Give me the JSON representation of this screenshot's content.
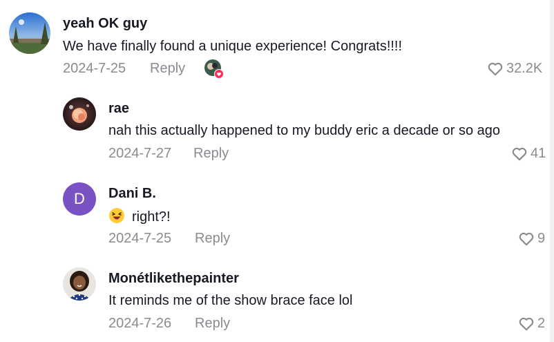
{
  "comments": [
    {
      "username": "yeah OK guy",
      "text": "We have finally found a unique experience! Congrats!!!!",
      "date": "2024-7-25",
      "reply_label": "Reply",
      "likes": "32.2K"
    }
  ],
  "replies": [
    {
      "username": "rae",
      "text": "nah this actually happened to my buddy eric a decade or so ago",
      "date": "2024-7-27",
      "reply_label": "Reply",
      "likes": "41"
    },
    {
      "username": "Dani B.",
      "avatar_letter": "D",
      "emoji_icon": "laughing-emoji",
      "text": "right?!",
      "date": "2024-7-25",
      "reply_label": "Reply",
      "likes": "9"
    },
    {
      "username": "Monétlikethepainter",
      "text": "It reminds me of the show brace face lol",
      "date": "2024-7-26",
      "reply_label": "Reply",
      "likes": "2"
    }
  ],
  "colors": {
    "muted_text": "#8a8b91",
    "primary_text": "#161823",
    "avatar_purple": "#7b52c4",
    "creator_liked_badge": "#fe2c55"
  },
  "icons": {
    "like": "heart-outline-icon",
    "creator_liked": "creator-liked-heart-icon"
  }
}
